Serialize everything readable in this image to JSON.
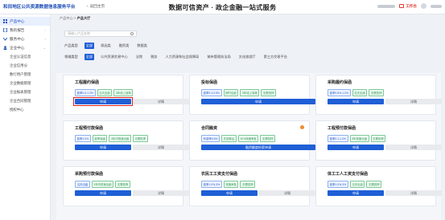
{
  "header": {
    "brand": "和田地区公共资源数据信息服务平台",
    "back_label": "返回主页",
    "title": "数据可信资产 · 政企金融一站式服务",
    "workbench_label": "工作台"
  },
  "sidebar": {
    "items": [
      {
        "label": "产品中心",
        "active": true
      },
      {
        "label": "我的报告"
      },
      {
        "label": "服务中心"
      },
      {
        "label": "企业中心"
      }
    ],
    "subitems": [
      "企业认证信息",
      "企业信用分",
      "数行用户管理",
      "企业数据管理",
      "企业报表管理",
      "企业合同管理",
      "授权中心"
    ]
  },
  "breadcrumb": {
    "parent": "产品中心",
    "sep": ">",
    "current": "产品大厅"
  },
  "search": {
    "placeholder": "请输入产品名称"
  },
  "filters": {
    "product_type": {
      "label": "产品类型",
      "options": [
        "全部",
        "保函类",
        "融资类",
        "数据类"
      ],
      "selected": 0
    },
    "domain": {
      "label": "领域类型",
      "options": [
        "全部",
        "公共资源交易中心",
        "法院",
        "税务",
        "人力资源和社会保障局",
        "城市管理执法局",
        "文化旅游厅",
        "第三方交易平台"
      ],
      "selected": 0
    }
  },
  "cards": [
    {
      "title": "工程履约保函",
      "tags": [
        "费率0.6-1.2%",
        "当天出函",
        "3年线上保单"
      ],
      "apply": "申请",
      "detail": "详情",
      "highlight": true
    },
    {
      "title": "投标保函",
      "tags": [
        "费率0.3-0.5%",
        "即时出函",
        "3年线上保单",
        "无需抵押"
      ],
      "apply": "申请",
      "detail": "",
      "highlight": false
    },
    {
      "title": "采购履约保函",
      "tags": [
        "费率0.8%-1.0%",
        "当天出函",
        "无需抵押"
      ],
      "apply": "申请",
      "detail": "详情",
      "highlight": false
    },
    {
      "title": "工程预付款保函",
      "tags": [
        "费率1.0%",
        "费率保函",
        "3年内快速出函",
        "无需抵押"
      ],
      "apply": "申请",
      "detail": "详情",
      "highlight": false
    },
    {
      "title": "合同融资",
      "tags": [
        "年费率5.8%",
        "先放款后",
        "30%快速审批",
        "无需抵押"
      ],
      "apply": "融资额度检索申请",
      "detail": "",
      "highlight": false,
      "wide": true,
      "badge": true
    },
    {
      "title": "工程预付款保函",
      "tags": [
        "费率0.1-1.2%",
        "3年快速出函",
        "无需抵押"
      ],
      "apply": "申请",
      "detail": "详情",
      "highlight": false
    },
    {
      "title": "采购预付款保函",
      "tags": [
        "当天出函",
        "3年内快速出函",
        "无需抵押"
      ],
      "apply": "申请",
      "detail": "详情",
      "highlight": false
    },
    {
      "title": "农民工工资支付保函",
      "tags": [
        "费率1.0%-3%",
        "快速审批",
        "无需抵押"
      ],
      "apply": "申请",
      "detail": "详情",
      "highlight": false
    },
    {
      "title": "体工工人工资支付保函",
      "tags": [
        "费率1.0%-3%",
        "当天出函",
        "无需抵押"
      ],
      "apply": "申请",
      "detail": "详情",
      "highlight": false
    }
  ]
}
